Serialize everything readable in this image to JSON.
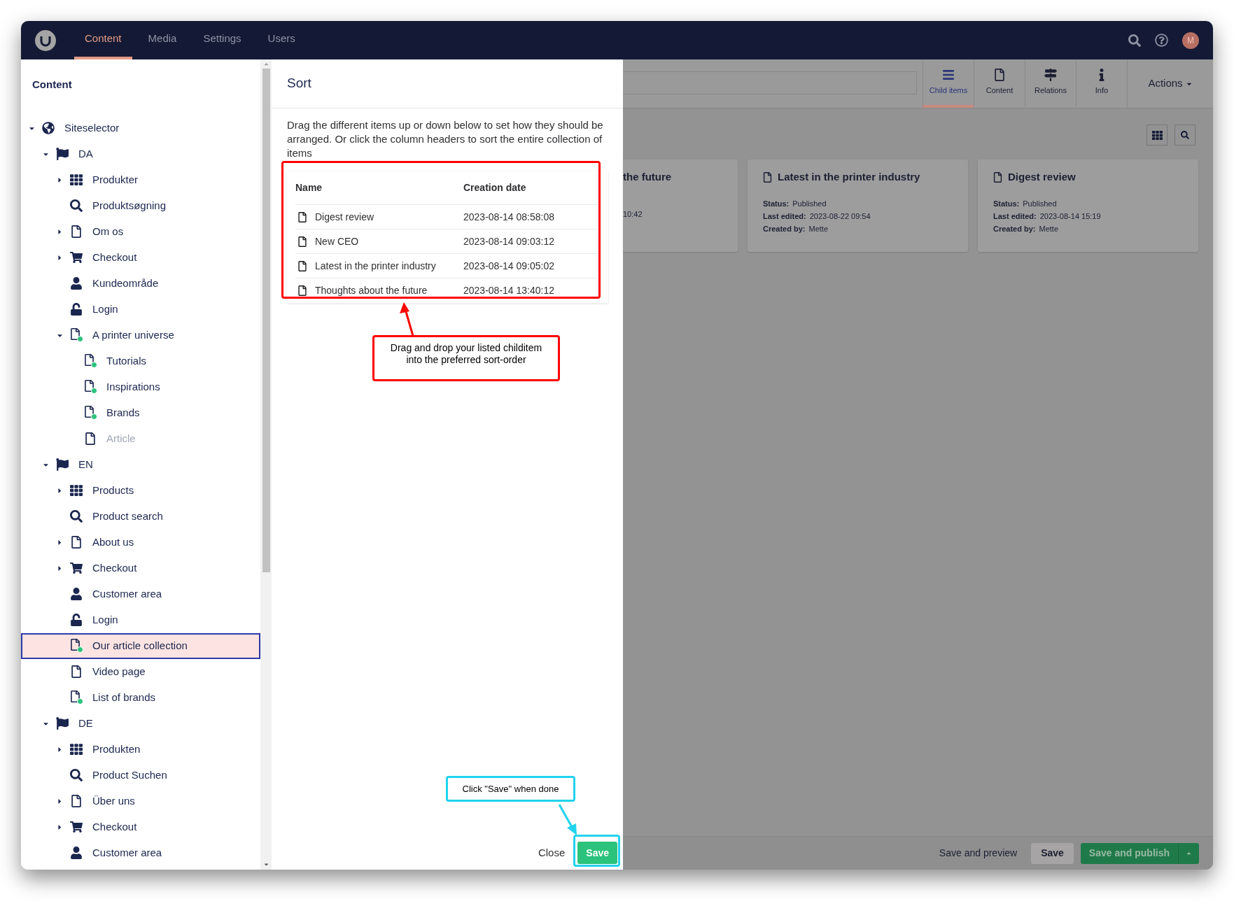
{
  "top_nav": {
    "sections": [
      {
        "label": "Content",
        "selected": true
      },
      {
        "label": "Media",
        "selected": false
      },
      {
        "label": "Settings",
        "selected": false
      },
      {
        "label": "Users",
        "selected": false
      }
    ],
    "avatar": "M"
  },
  "sidebar": {
    "title": "Content",
    "tree": [
      {
        "label": "Siteselector",
        "kind": "globe",
        "expandable": true,
        "expanded": true,
        "selected": false,
        "dimmed": false,
        "children": [
          {
            "label": "DA",
            "kind": "flag",
            "expandable": true,
            "expanded": true,
            "selected": false,
            "dimmed": false,
            "children": [
              {
                "label": "Produkter",
                "kind": "grid",
                "expandable": true,
                "expanded": false,
                "selected": false,
                "dimmed": false
              },
              {
                "label": "Produktsøgning",
                "kind": "search",
                "expandable": false,
                "selected": false,
                "dimmed": false
              },
              {
                "label": "Om os",
                "kind": "page",
                "expandable": true,
                "expanded": false,
                "selected": false,
                "dimmed": false
              },
              {
                "label": "Checkout",
                "kind": "cart",
                "expandable": true,
                "expanded": false,
                "selected": false,
                "dimmed": false
              },
              {
                "label": "Kundeområde",
                "kind": "user",
                "expandable": false,
                "selected": false,
                "dimmed": false
              },
              {
                "label": "Login",
                "kind": "unlock",
                "expandable": false,
                "selected": false,
                "dimmed": false
              },
              {
                "label": "A printer universe",
                "kind": "page-plus",
                "expandable": true,
                "expanded": true,
                "selected": false,
                "dimmed": false,
                "children": [
                  {
                    "label": "Tutorials",
                    "kind": "page-plus",
                    "expandable": false,
                    "selected": false,
                    "dimmed": false
                  },
                  {
                    "label": "Inspirations",
                    "kind": "page-plus",
                    "expandable": false,
                    "selected": false,
                    "dimmed": false
                  },
                  {
                    "label": "Brands",
                    "kind": "page-plus",
                    "expandable": false,
                    "selected": false,
                    "dimmed": false
                  },
                  {
                    "label": "Article",
                    "kind": "page",
                    "expandable": false,
                    "selected": false,
                    "dimmed": true
                  }
                ]
              }
            ]
          },
          {
            "label": "EN",
            "kind": "flag",
            "expandable": true,
            "expanded": true,
            "selected": false,
            "dimmed": false,
            "children": [
              {
                "label": "Products",
                "kind": "grid",
                "expandable": true,
                "expanded": false,
                "selected": false,
                "dimmed": false
              },
              {
                "label": "Product search",
                "kind": "search",
                "expandable": false,
                "selected": false,
                "dimmed": false
              },
              {
                "label": "About us",
                "kind": "page",
                "expandable": true,
                "expanded": false,
                "selected": false,
                "dimmed": false
              },
              {
                "label": "Checkout",
                "kind": "cart",
                "expandable": true,
                "expanded": false,
                "selected": false,
                "dimmed": false
              },
              {
                "label": "Customer area",
                "kind": "user",
                "expandable": false,
                "selected": false,
                "dimmed": false
              },
              {
                "label": "Login",
                "kind": "unlock",
                "expandable": false,
                "selected": false,
                "dimmed": false
              },
              {
                "label": "Our article collection",
                "kind": "page-plus",
                "expandable": false,
                "selected": true,
                "dimmed": false
              },
              {
                "label": "Video page",
                "kind": "page",
                "expandable": false,
                "selected": false,
                "dimmed": false
              },
              {
                "label": "List of brands",
                "kind": "page-plus",
                "expandable": false,
                "selected": false,
                "dimmed": false
              }
            ]
          },
          {
            "label": "DE",
            "kind": "flag",
            "expandable": true,
            "expanded": true,
            "selected": false,
            "dimmed": false,
            "children": [
              {
                "label": "Produkten",
                "kind": "grid",
                "expandable": true,
                "expanded": false,
                "selected": false,
                "dimmed": false
              },
              {
                "label": "Product Suchen",
                "kind": "search",
                "expandable": false,
                "selected": false,
                "dimmed": false
              },
              {
                "label": "Über uns",
                "kind": "page",
                "expandable": true,
                "expanded": false,
                "selected": false,
                "dimmed": false
              },
              {
                "label": "Checkout",
                "kind": "cart",
                "expandable": true,
                "expanded": false,
                "selected": false,
                "dimmed": false
              },
              {
                "label": "Customer area",
                "kind": "user",
                "expandable": false,
                "selected": false,
                "dimmed": false
              }
            ]
          }
        ]
      }
    ]
  },
  "sort_dialog": {
    "title": "Sort",
    "description": "Drag the different items up or down below to set how they should be arranged. Or click the column headers to sort the entire collection of items",
    "columns": [
      "Name",
      "Creation date"
    ],
    "rows": [
      {
        "name": "Digest review",
        "date": "2023-08-14 08:58:08"
      },
      {
        "name": "New CEO",
        "date": "2023-08-14 09:03:12"
      },
      {
        "name": "Latest in the printer industry",
        "date": "2023-08-14 09:05:02"
      },
      {
        "name": "Thoughts about the future",
        "date": "2023-08-14 13:40:12"
      }
    ],
    "buttons": [
      "Close",
      "Save"
    ]
  },
  "editor": {
    "apps": [
      {
        "label": "Child items",
        "kind": "list",
        "selected": true
      },
      {
        "label": "Content",
        "kind": "page",
        "selected": false
      },
      {
        "label": "Relations",
        "kind": "signpost",
        "selected": false
      },
      {
        "label": "Info",
        "kind": "info",
        "selected": false
      }
    ],
    "actions": "Actions",
    "cards": [
      {
        "title": "the future",
        "kind": "clipped",
        "fields": [
          {
            "value": "10:42"
          }
        ]
      },
      {
        "title": "Latest in the printer industry",
        "kind": "full",
        "fields": [
          {
            "label": "Status:",
            "value": "Published"
          },
          {
            "label": "Last edited:",
            "value": "2023-08-22 09:54"
          },
          {
            "label": "Created by:",
            "value": "Mette"
          }
        ]
      },
      {
        "title": "Digest review",
        "kind": "full",
        "fields": [
          {
            "label": "Status:",
            "value": "Published"
          },
          {
            "label": "Last edited:",
            "value": "2023-08-14 15:19"
          },
          {
            "label": "Created by:",
            "value": "Mette"
          }
        ]
      }
    ],
    "footer_buttons": [
      "Save and preview",
      "Save",
      "Save and publish"
    ]
  },
  "annotations": [
    {
      "text": "Drag and drop your listed childitem into the preferred sort-order",
      "color": "#ff0000"
    },
    {
      "text": "Click \"Save\" when done",
      "color": "#22d3ee"
    }
  ]
}
